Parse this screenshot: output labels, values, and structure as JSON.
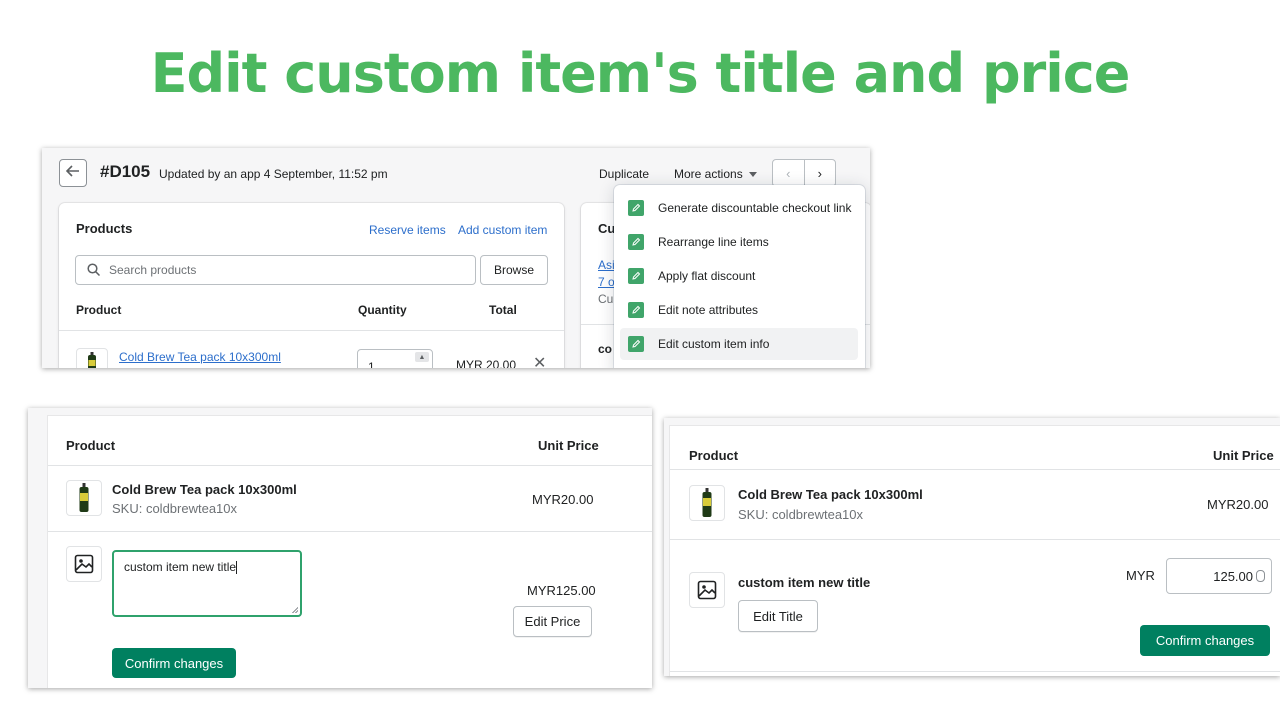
{
  "headline": "Edit custom item's title and price",
  "order": {
    "number": "#D105",
    "subtitle": "Updated by an app 4 September, 11:52 pm",
    "duplicate_label": "Duplicate",
    "more_actions_label": "More actions",
    "products_title": "Products",
    "reserve_link": "Reserve items",
    "add_custom_link": "Add custom item",
    "search_placeholder": "Search products",
    "browse_label": "Browse",
    "col_product": "Product",
    "col_quantity": "Quantity",
    "col_total": "Total",
    "line_item": {
      "name": "Cold Brew Tea pack 10x300ml",
      "quantity": "1",
      "total": "MYR 20.00"
    },
    "customer_card": {
      "title_partial": "Cu",
      "link1_partial": "Asi",
      "link2_partial": "7 o",
      "text_partial": "Cu",
      "section_partial": "co"
    },
    "menu_items": [
      {
        "label": "Generate discountable checkout link",
        "active": false
      },
      {
        "label": "Rearrange line items",
        "active": false
      },
      {
        "label": "Apply flat discount",
        "active": false
      },
      {
        "label": "Edit note attributes",
        "active": false
      },
      {
        "label": "Edit custom item info",
        "active": true
      }
    ],
    "accent_color": "#40a56a"
  },
  "edit_title_panel": {
    "col_product": "Product",
    "col_unit_price": "Unit Price",
    "product": {
      "name": "Cold Brew Tea pack 10x300ml",
      "sku": "SKU: coldbrewtea10x",
      "price": "MYR20.00"
    },
    "custom_item": {
      "title_value": "custom item new title",
      "price": "MYR125.00"
    },
    "edit_price_label": "Edit Price",
    "confirm_label": "Confirm changes"
  },
  "edit_price_panel": {
    "col_product": "Product",
    "col_unit_price": "Unit Price",
    "product": {
      "name": "Cold Brew Tea pack 10x300ml",
      "sku": "SKU: coldbrewtea10x",
      "price": "MYR20.00"
    },
    "custom_item": {
      "title": "custom item new title",
      "currency": "MYR",
      "price_value": "125.00"
    },
    "edit_title_label": "Edit Title",
    "confirm_label": "Confirm changes"
  }
}
